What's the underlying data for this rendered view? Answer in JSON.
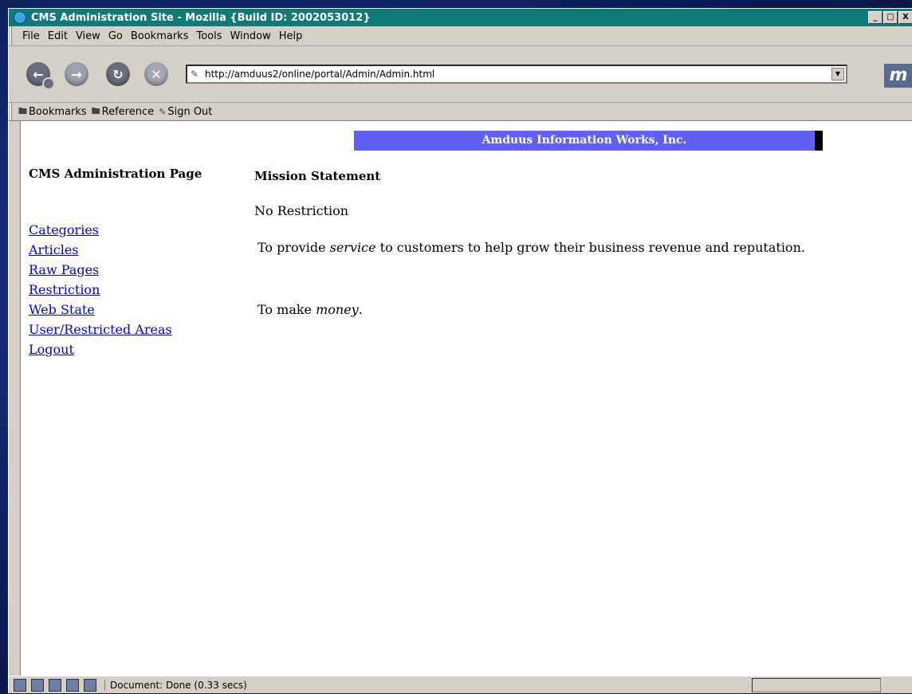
{
  "window": {
    "title": "CMS Administration Site - Mozilla {Build ID: 2002053012}",
    "buttons": [
      "_",
      "□",
      "X"
    ]
  },
  "menubar": {
    "items": [
      "File",
      "Edit",
      "View",
      "Go",
      "Bookmarks",
      "Tools",
      "Window",
      "Help"
    ]
  },
  "navbar": {
    "url": "http://amduus2/online/portal/Admin/Admin.html"
  },
  "personalbar": {
    "items": [
      {
        "icon": "folder-icon",
        "label": "Bookmarks"
      },
      {
        "icon": "folder-icon",
        "label": "Reference"
      },
      {
        "icon": "link-icon",
        "label": "Sign Out"
      }
    ]
  },
  "page": {
    "banner": "Amduus Information Works, Inc.",
    "sidebar": {
      "title": "CMS Administration Page",
      "links": [
        "Categories",
        "Articles",
        "Raw Pages",
        "Restriction",
        "Web State",
        "User/Restricted Areas",
        "Logout"
      ]
    },
    "main": {
      "title": "Mission Statement",
      "subtitle": "No Restriction",
      "para1": {
        "before": "To provide ",
        "em": "service",
        "after": " to customers to help grow their business revenue and reputation."
      },
      "para2": {
        "before": "To make ",
        "em": "money",
        "after": "."
      }
    }
  },
  "statusbar": {
    "text": "Document: Done (0.33 secs)"
  },
  "colors": {
    "titlebar": "#0e7a79",
    "banner": "#6060f7",
    "link": "#0000ee"
  }
}
